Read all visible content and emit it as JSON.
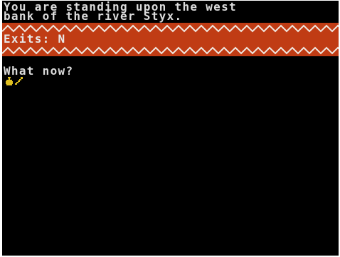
{
  "description": {
    "line1": "You are standing upon the west",
    "line2": "bank of the river Styx."
  },
  "exits": {
    "text": "Exits: N"
  },
  "prompt": {
    "text": "What now?"
  },
  "inventory": {
    "icons": [
      "bag-icon",
      "wand-icon"
    ]
  },
  "colors": {
    "background": "#000000",
    "text": "#dcdcdc",
    "border_red": "#c03c14",
    "zigzag": "#f0e8e0",
    "item_gold": "#e0c020"
  }
}
